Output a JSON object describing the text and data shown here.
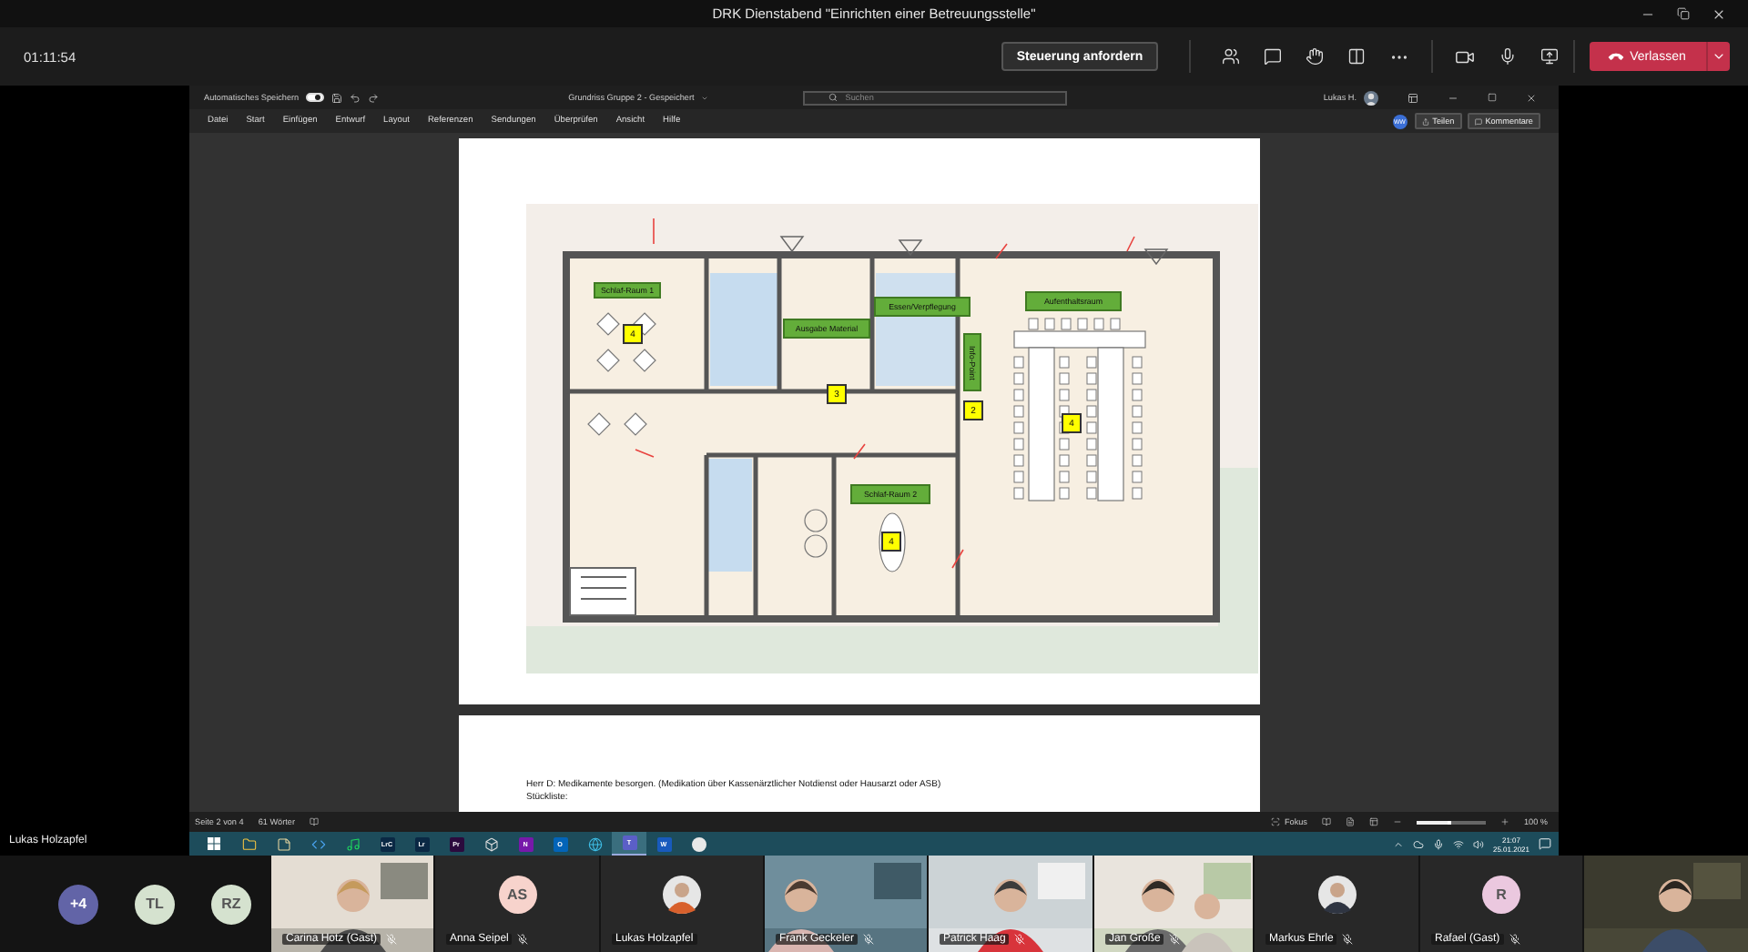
{
  "window": {
    "title": "DRK Dienstabend \"Einrichten einer Betreuungsstelle\""
  },
  "meeting_bar": {
    "timer": "01:11:54",
    "request_control": "Steuerung anfordern",
    "leave": "Verlassen"
  },
  "shared_screen": {
    "presenter": "Lukas Holzapfel",
    "word": {
      "autosave": {
        "label": "Automatisches Speichern",
        "on": true
      },
      "document_title": "Grundriss Gruppe 2 - Gespeichert",
      "search": {
        "placeholder": "Suchen"
      },
      "user": "Lukas H.",
      "ribbon_tabs": [
        "Datei",
        "Start",
        "Einfügen",
        "Entwurf",
        "Layout",
        "Referenzen",
        "Sendungen",
        "Überprüfen",
        "Ansicht",
        "Hilfe"
      ],
      "account_initials": "WW",
      "share": "Teilen",
      "comments": "Kommentare",
      "floor_plan": {
        "labels": [
          {
            "text": "Schlaf-Raum 1",
            "vertical": false
          },
          {
            "text": "Ausgabe Material",
            "vertical": false
          },
          {
            "text": "Essen/Verpflegung",
            "vertical": false
          },
          {
            "text": "Aufenthaltsraum",
            "vertical": false
          },
          {
            "text": "Info-Point",
            "vertical": true
          },
          {
            "text": "Schlaf-Raum 2",
            "vertical": false
          }
        ],
        "markers": [
          "4",
          "3",
          "2",
          "4",
          "4"
        ]
      },
      "page_2": {
        "lines": [
          "Herr D: Medikamente besorgen. (Medikation über Kassenärztlicher Notdienst oder Hausarzt oder ASB)",
          "Stückliste:"
        ]
      },
      "status_bar": {
        "page": "Seite 2 von 4",
        "words": "61 Wörter",
        "focus": "Fokus",
        "zoom": {
          "level": 0.5,
          "reading": "100 %"
        }
      }
    },
    "taskbar": {
      "apps": [
        {
          "kind": "start",
          "selected": false
        },
        {
          "kind": "folder",
          "selected": false
        },
        {
          "kind": "notes",
          "selected": false
        },
        {
          "kind": "code",
          "selected": false
        },
        {
          "kind": "music",
          "selected": false
        },
        {
          "kind": "tile",
          "label": "LrC",
          "color": "#0a2844",
          "selected": false
        },
        {
          "kind": "tile",
          "label": "Lr",
          "color": "#0a2844",
          "selected": false
        },
        {
          "kind": "tile",
          "label": "Pr",
          "color": "#2b0a3d",
          "selected": false
        },
        {
          "kind": "cube",
          "selected": false
        },
        {
          "kind": "tile",
          "label": "N",
          "color": "#7719aa",
          "selected": false
        },
        {
          "kind": "tile",
          "label": "O",
          "color": "#0364b8",
          "selected": false
        },
        {
          "kind": "browser",
          "selected": false
        },
        {
          "kind": "tile",
          "label": "T",
          "color": "#5b5fc7",
          "selected": true
        },
        {
          "kind": "tile",
          "label": "W",
          "color": "#185abd",
          "selected": false
        },
        {
          "kind": "ball",
          "selected": false
        }
      ],
      "time": "21:07",
      "date": "25.01.2021"
    }
  },
  "participants": {
    "overflow": [
      {
        "label": "+4",
        "color": "#6264a7"
      },
      {
        "label": "TL",
        "color": "#d5e2cf"
      },
      {
        "label": "RZ",
        "color": "#d5e2cf"
      }
    ],
    "tiles": [
      {
        "kind": "video",
        "name": "Carina Hotz (Gast)",
        "muted": true
      },
      {
        "kind": "initials",
        "initials": "AS",
        "color": "#f7d3cc",
        "name": "Anna Seipel",
        "muted": true
      },
      {
        "name": "Lukas Holzapfel",
        "muted": false
      },
      {
        "kind": "video",
        "name": "Frank Geckeler",
        "muted": true
      },
      {
        "kind": "video",
        "name": "Patrick Haag",
        "muted": true
      },
      {
        "kind": "video",
        "name": "Jan Große",
        "muted": true
      },
      {
        "name": "Markus Ehrle",
        "muted": true
      },
      {
        "kind": "initials",
        "initials": "R",
        "color": "#ebc8df",
        "name": "Rafael (Gast)",
        "muted": true
      },
      {
        "kind": "video"
      }
    ]
  }
}
